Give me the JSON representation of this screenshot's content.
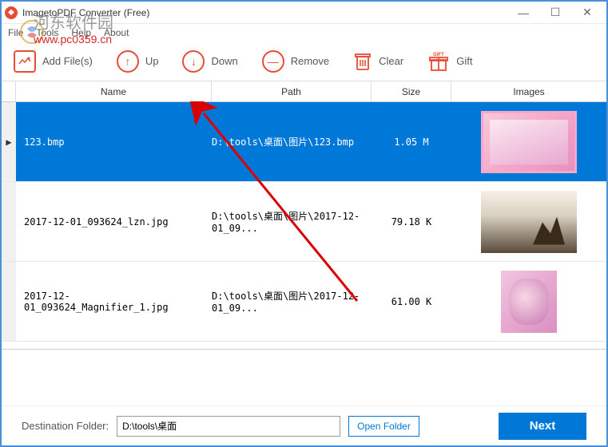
{
  "window": {
    "title": "ImagetoPDF Converter (Free)"
  },
  "menu": {
    "file": "File",
    "tools": "Tools",
    "help": "Help",
    "about": "About"
  },
  "watermark": {
    "text": "河东软件园",
    "url": "www.pc0359.cn"
  },
  "toolbar": {
    "addfiles": "Add File(s)",
    "up": "Up",
    "down": "Down",
    "remove": "Remove",
    "clear": "Clear",
    "gift": "Gift"
  },
  "columns": {
    "name": "Name",
    "path": "Path",
    "size": "Size",
    "images": "Images"
  },
  "rows": [
    {
      "marker": "▶",
      "name": "123.bmp",
      "path": "D:\\tools\\桌面\\图片\\123.bmp",
      "size": "1.05 M",
      "selected": true,
      "thumbClass": "thumb1"
    },
    {
      "marker": "",
      "name": "2017-12-01_093624_lzn.jpg",
      "path": "D:\\tools\\桌面\\图片\\2017-12-01_09...",
      "size": "79.18 K",
      "selected": false,
      "thumbClass": "thumb2"
    },
    {
      "marker": "",
      "name": "2017-12-01_093624_Magnifier_1.jpg",
      "path": "D:\\tools\\桌面\\图片\\2017-12-01_09...",
      "size": "61.00 K",
      "selected": false,
      "thumbClass": "thumb3"
    }
  ],
  "footer": {
    "label": "Destination Folder:",
    "path": "D:\\tools\\桌面",
    "open": "Open Folder",
    "next": "Next"
  }
}
